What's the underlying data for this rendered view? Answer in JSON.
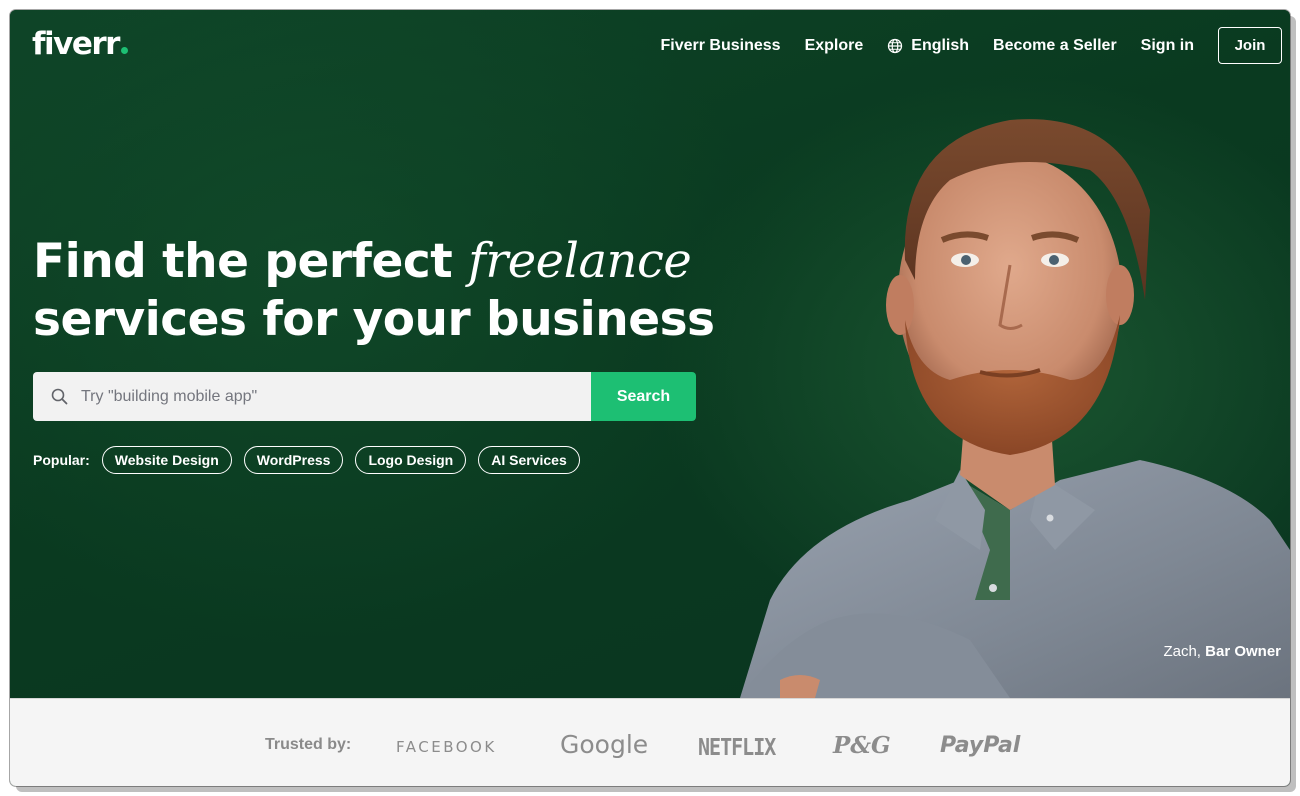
{
  "brand": {
    "name": "fiverr",
    "accent_color": "#1dbf73",
    "hero_color": "#0b3a21"
  },
  "nav": {
    "links": [
      {
        "label": "Fiverr Business"
      },
      {
        "label": "Explore"
      },
      {
        "label": "English",
        "icon": "globe-icon"
      },
      {
        "label": "Become a Seller"
      },
      {
        "label": "Sign in"
      }
    ],
    "join_label": "Join"
  },
  "hero": {
    "headline_part1": "Find the perfect ",
    "headline_italic": "freelance",
    "headline_part2": "services for your business",
    "search": {
      "placeholder": "Try \"building mobile app\"",
      "value": "",
      "button_label": "Search",
      "icon": "search-icon"
    },
    "popular": {
      "label": "Popular:",
      "tags": [
        "Website Design",
        "WordPress",
        "Logo Design",
        "AI Services"
      ]
    },
    "caption": {
      "name": "Zach,",
      "role": "Bar Owner"
    }
  },
  "trusted": {
    "label": "Trusted by:",
    "brands": [
      "FACEBOOK",
      "Google",
      "NETFLIX",
      "P&G",
      "PayPal"
    ]
  }
}
